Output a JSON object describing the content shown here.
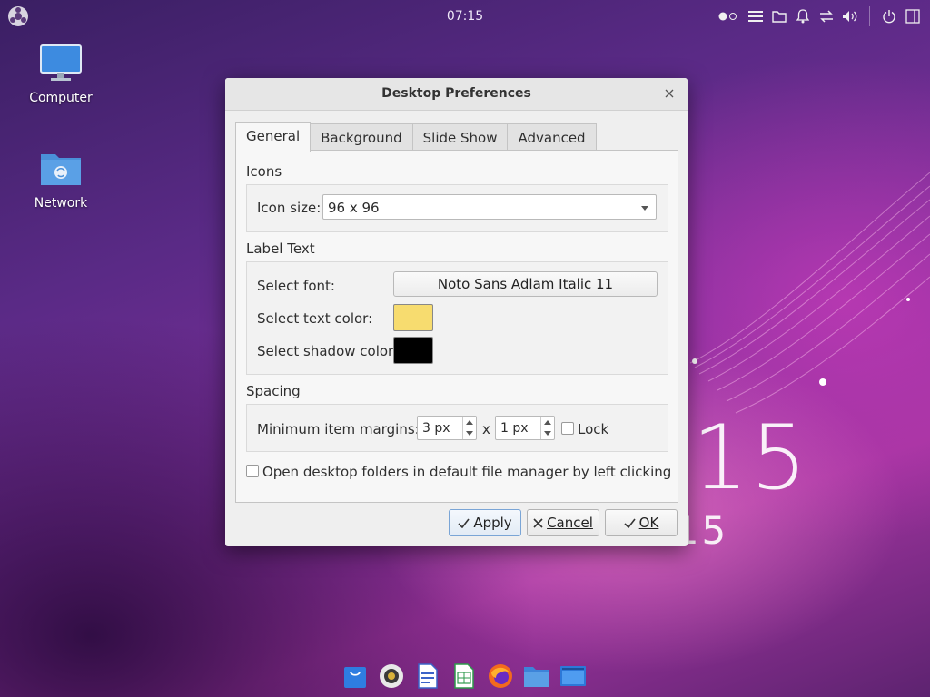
{
  "panel": {
    "clock": "07:15"
  },
  "desktop": {
    "icons": [
      {
        "label": "Computer",
        "icon": "monitor-icon"
      },
      {
        "label": "Network",
        "icon": "network-folder-icon"
      }
    ],
    "wallpaper_number": "15",
    "wallpaper_subtitle": "ne 15"
  },
  "dialog": {
    "title": "Desktop Preferences",
    "tabs": [
      "General",
      "Background",
      "Slide Show",
      "Advanced"
    ],
    "active_tab": "General",
    "icons_section": {
      "heading": "Icons",
      "icon_size_label": "Icon size:",
      "icon_size_value": "96 x 96"
    },
    "label_text_section": {
      "heading": "Label Text",
      "font_label": "Select font:",
      "font_value": "Noto Sans Adlam Italic 11",
      "text_color_label": "Select text color:",
      "text_color": "#f7dc6f",
      "shadow_color_label": "Select shadow color:",
      "shadow_color": "#000000"
    },
    "spacing_section": {
      "heading": "Spacing",
      "margins_label": "Minimum item margins:",
      "margin_x": "3 px",
      "times": "x",
      "margin_y": "1 px",
      "lock_label": "Lock"
    },
    "open_folders_label": "Open desktop folders in default file manager by left clicking",
    "buttons": {
      "apply": "Apply",
      "cancel": "Cancel",
      "ok": "OK"
    }
  }
}
